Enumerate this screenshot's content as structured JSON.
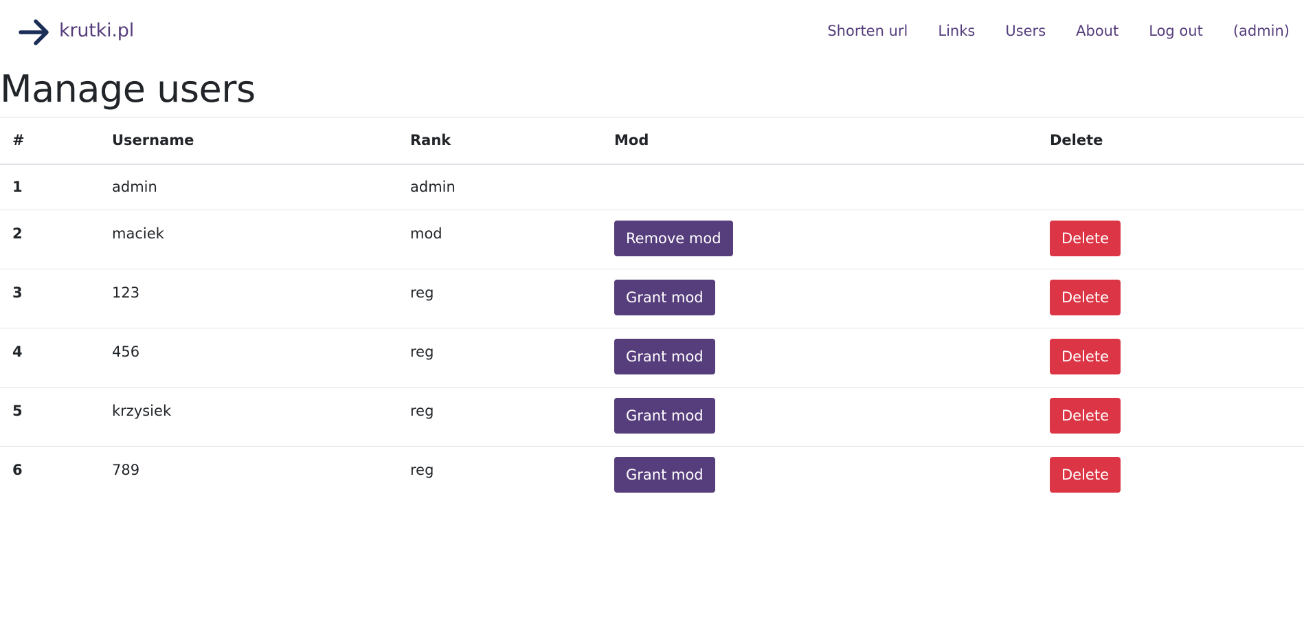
{
  "brand": {
    "name": "krutki.pl",
    "icon": "arrow-right-icon",
    "icon_color": "#1b2e57"
  },
  "nav": {
    "items": [
      {
        "label": "Shorten url"
      },
      {
        "label": "Links"
      },
      {
        "label": "Users"
      },
      {
        "label": "About"
      },
      {
        "label": "Log out"
      },
      {
        "label": "(admin)"
      }
    ]
  },
  "page": {
    "title": "Manage users"
  },
  "table": {
    "columns": [
      "#",
      "Username",
      "Rank",
      "Mod",
      "Delete"
    ],
    "rows": [
      {
        "num": "1",
        "username": "admin",
        "rank": "admin",
        "mod_action": null,
        "delete_action": null
      },
      {
        "num": "2",
        "username": "maciek",
        "rank": "mod",
        "mod_action": "Remove mod",
        "delete_action": "Delete"
      },
      {
        "num": "3",
        "username": "123",
        "rank": "reg",
        "mod_action": "Grant mod",
        "delete_action": "Delete"
      },
      {
        "num": "4",
        "username": "456",
        "rank": "reg",
        "mod_action": "Grant mod",
        "delete_action": "Delete"
      },
      {
        "num": "5",
        "username": "krzysiek",
        "rank": "reg",
        "mod_action": "Grant mod",
        "delete_action": "Delete"
      },
      {
        "num": "6",
        "username": "789",
        "rank": "reg",
        "mod_action": "Grant mod",
        "delete_action": "Delete"
      }
    ]
  },
  "colors": {
    "accent": "#563d7c",
    "danger": "#dc3545",
    "text": "#212529",
    "border": "#dee2e6"
  }
}
